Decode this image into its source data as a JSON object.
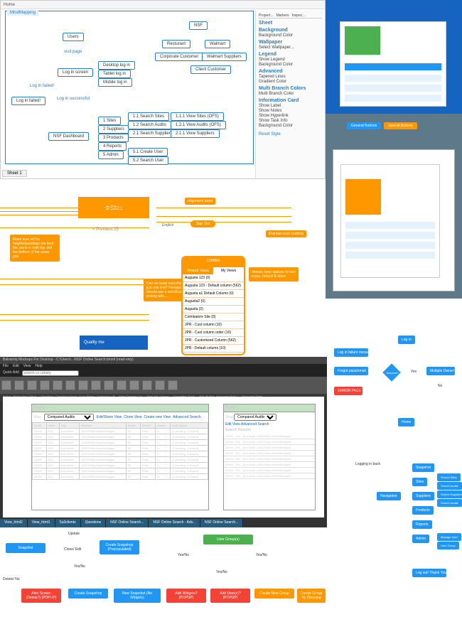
{
  "toolbar": {
    "home": "Home"
  },
  "mindmap": {
    "title": "MindMapping",
    "sheet": "Sheet 1",
    "nodes": {
      "users": "Users",
      "visit": "visit page",
      "login": "Log in screen",
      "fail_txt": "Log in failed!",
      "fail": "Log in failed!",
      "success": "Log in successful",
      "dash": "NSF Dashboard",
      "desktop": "Desktop log in",
      "tablet": "Tablet log in",
      "mobile": "Mobile log in",
      "nsf": "NSF",
      "rest": "Resturant",
      "walmart": "Walmart",
      "corp": "Corporate Customer",
      "wsup": "Walmart Suppliers",
      "client": "Client Customer",
      "d1": "1  Sites",
      "d2": "2  Suppliers",
      "d3": "3  Products",
      "d4": "4  Reports",
      "d5": "5  Admin",
      "s11": "1.1  Search Sites",
      "s12": "1.2  Search Audits",
      "s21": "2.1  Search Suppliers",
      "s51": "5.1  Create User",
      "s52": "5.2  Search User",
      "s111": "1.1.1  View Sites (OFS)",
      "s121": "1.2.1  View Audits (OFS)",
      "s211": "2.1.1  View Suppliers"
    },
    "sidebar": {
      "sheet": "Sheet",
      "bg": "Background",
      "bgcolor": "Background Color",
      "wallpaper": "Wallpaper",
      "select": "Select Wallpaper...",
      "legend": "Legend",
      "showl": "Show Legend",
      "adv": "Advanced",
      "tapered": "Tapered Lines",
      "grad": "Gradient Color",
      "mbc": "Multi Branch Colors",
      "mbc2": "Multi Branch Color",
      "info": "Information Card",
      "slabel": "Show Label",
      "snotes": "Show Notes",
      "shyper": "Show Hyperlink",
      "stask": "Show Task Info",
      "reset": "Reset Style",
      "tabs": {
        "p": "Propert...",
        "m": "Markers",
        "i": "Inspec..."
      }
    }
  },
  "blue": {
    "btn_general": "General Buttons",
    "btn_special": "Special Buttons"
  },
  "mid": {
    "sites": "Sites",
    "prev": "< Previous 25",
    "note1": "Make sure all the heights/paddings are kept the same in both top and the bottom of the views grid.",
    "note2": "Can we keep everything in just one line? Perhaps we should use a word/icon ending with...",
    "align": "Alignment issue",
    "english": "English",
    "signout": "Sign Out",
    "note3": "Maintain eqal padding",
    "phone_top": "1234569",
    "tab_shared": "Shared Views",
    "tab_my": "My Views",
    "items": [
      "Augusta 123 (0)",
      "Augusta 123 - Default column (562)",
      "Augusta a1 Default Column (0)",
      "Augusta2 (0)",
      "Augusta (2)",
      "Coimbatore Site (0)",
      "JPR - Cust column (10)",
      "JPR - Cust column order (10)",
      "JPR - Customized Column (562)",
      "JPR - Default column (10)"
    ],
    "note4": "Always keep spaces for two icons, Default & More",
    "quality": "Quality me"
  },
  "bals": {
    "title": "Balsamiq Mockups For Desktop - C:\\Users\\...\\NSF Online Search.bmml (read-only)",
    "menu": [
      "File",
      "Edit",
      "View",
      "Help"
    ],
    "quick": "Quick Add",
    "quick_ph": "Search UI Library",
    "tool_labels": [
      "Button",
      "Button Bar / Tab B...",
      "Checkbox",
      "Checkbox Group",
      "Color Picker",
      "Combobox / P...",
      "Date Chooser / Ca...",
      "Field Set / Group ...",
      "Formatting Toolb...",
      "Help Button",
      "Horizontal Rule /...",
      "Horizontal Slider"
    ],
    "pane1": {
      "title": "Audits",
      "view": "Compared Audits",
      "links": [
        "Edit/Share View",
        "Clone View",
        "Create new View",
        "Advanced Search"
      ],
      "cols": [
        "Audit",
        "Start",
        "City",
        "Division",
        "Score",
        "Result",
        "Grade",
        "CAR status"
      ],
      "row": [
        "40001",
        "501",
        "Ann Arbor",
        "US/US/Mid-West/Michigan",
        "90",
        "Pass",
        "A",
        "(2 pending, 3 closed)"
      ]
    },
    "pane2": {
      "title": "Audits",
      "view": "Compared Audits",
      "links": [
        "Edit View",
        "Advanced Search"
      ],
      "results": "Search Results",
      "row": "40001 - 501 - Ann Arbor \\US/US/Mid-West/Michigan"
    },
    "tabs": [
      "View_html2",
      "View_html1",
      "Sa3clients",
      "Questions",
      "NSF Online Search...",
      "NSF Online Search - Adv...",
      "NSF Online Search..."
    ]
  },
  "flow1": {
    "login": "Log in",
    "failmsg": "Log in failure message",
    "forgot": "Forgot pass/email",
    "error": "ERROR PAGE",
    "success": "Success?",
    "yes": "Yes",
    "no": "No",
    "multi": "Multiple Owner?",
    "home": "Home",
    "logback": "Logging in back",
    "snap": "Snapshot",
    "sites": "Sites",
    "sup": "Suppliers",
    "prod": "Products",
    "rep": "Reports",
    "admin": "Admin",
    "nav": "Navigation",
    "ssites": "Search Sites",
    "saud": "Search Audits",
    "ssup": "Search Suppliers",
    "saud2": "Search Audits",
    "muser": "Manage User",
    "ugroup": "User Group",
    "logout": "Log out! Thank You"
  },
  "flow2": {
    "snap": "Snapshot",
    "update": "Update",
    "clone": "Clone/ Edit",
    "create": "Create Snapshop (Prepopulated)",
    "yesno": "Yes/No",
    "alert": "Alert Screen (Delete?) (POPUP)",
    "csnap": "Create Snapshop",
    "nsnap": "New Snapshot (No Widgets)",
    "deleteno": "Delete/ No",
    "ugroup": "User Group(s)",
    "addw": "Add Widgets? (POPUP)",
    "addu": "Add User(s)? (POPUP)",
    "cnew": "Create New Group",
    "cclone": "Create Group By Clonning"
  }
}
